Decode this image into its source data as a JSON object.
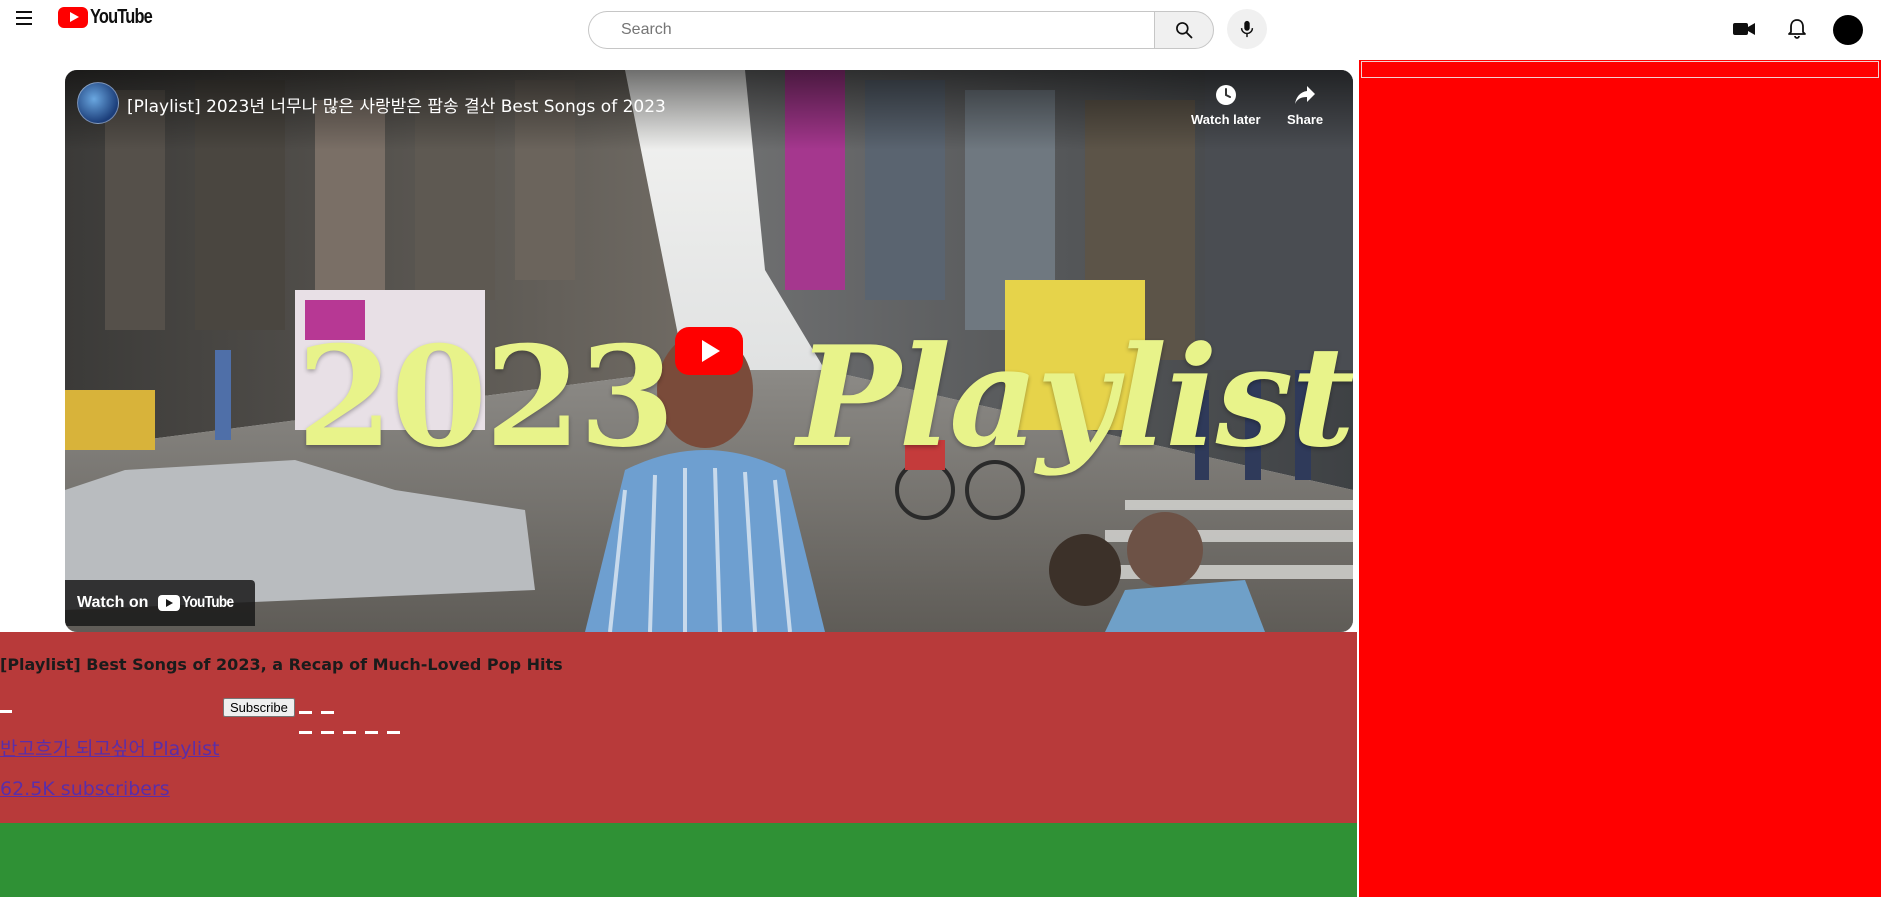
{
  "header": {
    "logo_text": "YouTube",
    "search": {
      "placeholder": "Search",
      "value": ""
    },
    "icons": {
      "menu": "hamburger-menu-icon",
      "search": "search-icon",
      "mic": "microphone-icon",
      "create": "video-camera-icon",
      "notifications": "bell-icon",
      "avatar": "user-avatar"
    }
  },
  "player": {
    "title": "[Playlist] 2023년 너무나 많은 사랑받은 팝송 결산 Best Songs of 2023",
    "watch_later_label": "Watch later",
    "share_label": "Share",
    "overlay_year": "2023",
    "overlay_word": "Playlist",
    "watch_on_label": "Watch on",
    "watch_on_logo": "YouTube"
  },
  "info": {
    "video_heading": "[Playlist] Best Songs of 2023, a Recap of Much-Loved Pop Hits",
    "subscribe_label": "Subscribe",
    "channel_name": "반고흐가 되고싶어 Playlist",
    "subscriber_count": "62.5K subscribers"
  },
  "colors": {
    "info_panel": "#b83a3a",
    "green_band": "#2f9135",
    "sidebar": "#ff0000",
    "overlay_text": "#e8f38a",
    "link": "#5a2ea8"
  }
}
